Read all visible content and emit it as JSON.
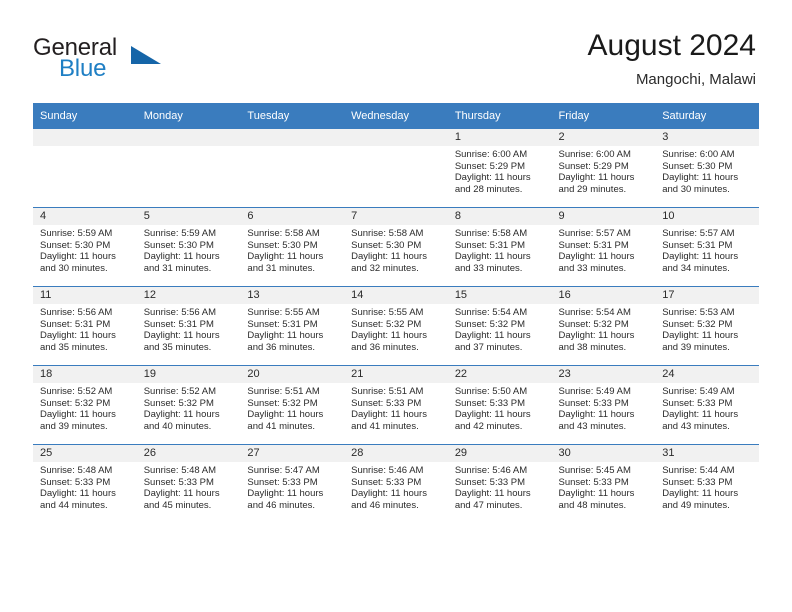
{
  "brand": {
    "name_part1": "General",
    "name_part2": "Blue",
    "logo_icon": "triangle-logo-icon",
    "accent_color": "#1f7fc4"
  },
  "header": {
    "title": "August 2024",
    "subtitle": "Mangochi, Malawi"
  },
  "theme": {
    "header_row_bg": "#3a7cbe",
    "daynum_band_bg": "#f1f1f1",
    "grid_line": "#3a7cbe",
    "text": "#2b2b2b"
  },
  "weekday_headers": [
    "Sunday",
    "Monday",
    "Tuesday",
    "Wednesday",
    "Thursday",
    "Friday",
    "Saturday"
  ],
  "weeks": [
    [
      {
        "day": "",
        "sunrise": "",
        "sunset": "",
        "daylight_line1": "",
        "daylight_line2": "",
        "empty": true
      },
      {
        "day": "",
        "sunrise": "",
        "sunset": "",
        "daylight_line1": "",
        "daylight_line2": "",
        "empty": true
      },
      {
        "day": "",
        "sunrise": "",
        "sunset": "",
        "daylight_line1": "",
        "daylight_line2": "",
        "empty": true
      },
      {
        "day": "",
        "sunrise": "",
        "sunset": "",
        "daylight_line1": "",
        "daylight_line2": "",
        "empty": true
      },
      {
        "day": "1",
        "sunrise": "Sunrise: 6:00 AM",
        "sunset": "Sunset: 5:29 PM",
        "daylight_line1": "Daylight: 11 hours",
        "daylight_line2": "and 28 minutes."
      },
      {
        "day": "2",
        "sunrise": "Sunrise: 6:00 AM",
        "sunset": "Sunset: 5:29 PM",
        "daylight_line1": "Daylight: 11 hours",
        "daylight_line2": "and 29 minutes."
      },
      {
        "day": "3",
        "sunrise": "Sunrise: 6:00 AM",
        "sunset": "Sunset: 5:30 PM",
        "daylight_line1": "Daylight: 11 hours",
        "daylight_line2": "and 30 minutes."
      }
    ],
    [
      {
        "day": "4",
        "sunrise": "Sunrise: 5:59 AM",
        "sunset": "Sunset: 5:30 PM",
        "daylight_line1": "Daylight: 11 hours",
        "daylight_line2": "and 30 minutes."
      },
      {
        "day": "5",
        "sunrise": "Sunrise: 5:59 AM",
        "sunset": "Sunset: 5:30 PM",
        "daylight_line1": "Daylight: 11 hours",
        "daylight_line2": "and 31 minutes."
      },
      {
        "day": "6",
        "sunrise": "Sunrise: 5:58 AM",
        "sunset": "Sunset: 5:30 PM",
        "daylight_line1": "Daylight: 11 hours",
        "daylight_line2": "and 31 minutes."
      },
      {
        "day": "7",
        "sunrise": "Sunrise: 5:58 AM",
        "sunset": "Sunset: 5:30 PM",
        "daylight_line1": "Daylight: 11 hours",
        "daylight_line2": "and 32 minutes."
      },
      {
        "day": "8",
        "sunrise": "Sunrise: 5:58 AM",
        "sunset": "Sunset: 5:31 PM",
        "daylight_line1": "Daylight: 11 hours",
        "daylight_line2": "and 33 minutes."
      },
      {
        "day": "9",
        "sunrise": "Sunrise: 5:57 AM",
        "sunset": "Sunset: 5:31 PM",
        "daylight_line1": "Daylight: 11 hours",
        "daylight_line2": "and 33 minutes."
      },
      {
        "day": "10",
        "sunrise": "Sunrise: 5:57 AM",
        "sunset": "Sunset: 5:31 PM",
        "daylight_line1": "Daylight: 11 hours",
        "daylight_line2": "and 34 minutes."
      }
    ],
    [
      {
        "day": "11",
        "sunrise": "Sunrise: 5:56 AM",
        "sunset": "Sunset: 5:31 PM",
        "daylight_line1": "Daylight: 11 hours",
        "daylight_line2": "and 35 minutes."
      },
      {
        "day": "12",
        "sunrise": "Sunrise: 5:56 AM",
        "sunset": "Sunset: 5:31 PM",
        "daylight_line1": "Daylight: 11 hours",
        "daylight_line2": "and 35 minutes."
      },
      {
        "day": "13",
        "sunrise": "Sunrise: 5:55 AM",
        "sunset": "Sunset: 5:31 PM",
        "daylight_line1": "Daylight: 11 hours",
        "daylight_line2": "and 36 minutes."
      },
      {
        "day": "14",
        "sunrise": "Sunrise: 5:55 AM",
        "sunset": "Sunset: 5:32 PM",
        "daylight_line1": "Daylight: 11 hours",
        "daylight_line2": "and 36 minutes."
      },
      {
        "day": "15",
        "sunrise": "Sunrise: 5:54 AM",
        "sunset": "Sunset: 5:32 PM",
        "daylight_line1": "Daylight: 11 hours",
        "daylight_line2": "and 37 minutes."
      },
      {
        "day": "16",
        "sunrise": "Sunrise: 5:54 AM",
        "sunset": "Sunset: 5:32 PM",
        "daylight_line1": "Daylight: 11 hours",
        "daylight_line2": "and 38 minutes."
      },
      {
        "day": "17",
        "sunrise": "Sunrise: 5:53 AM",
        "sunset": "Sunset: 5:32 PM",
        "daylight_line1": "Daylight: 11 hours",
        "daylight_line2": "and 39 minutes."
      }
    ],
    [
      {
        "day": "18",
        "sunrise": "Sunrise: 5:52 AM",
        "sunset": "Sunset: 5:32 PM",
        "daylight_line1": "Daylight: 11 hours",
        "daylight_line2": "and 39 minutes."
      },
      {
        "day": "19",
        "sunrise": "Sunrise: 5:52 AM",
        "sunset": "Sunset: 5:32 PM",
        "daylight_line1": "Daylight: 11 hours",
        "daylight_line2": "and 40 minutes."
      },
      {
        "day": "20",
        "sunrise": "Sunrise: 5:51 AM",
        "sunset": "Sunset: 5:32 PM",
        "daylight_line1": "Daylight: 11 hours",
        "daylight_line2": "and 41 minutes."
      },
      {
        "day": "21",
        "sunrise": "Sunrise: 5:51 AM",
        "sunset": "Sunset: 5:33 PM",
        "daylight_line1": "Daylight: 11 hours",
        "daylight_line2": "and 41 minutes."
      },
      {
        "day": "22",
        "sunrise": "Sunrise: 5:50 AM",
        "sunset": "Sunset: 5:33 PM",
        "daylight_line1": "Daylight: 11 hours",
        "daylight_line2": "and 42 minutes."
      },
      {
        "day": "23",
        "sunrise": "Sunrise: 5:49 AM",
        "sunset": "Sunset: 5:33 PM",
        "daylight_line1": "Daylight: 11 hours",
        "daylight_line2": "and 43 minutes."
      },
      {
        "day": "24",
        "sunrise": "Sunrise: 5:49 AM",
        "sunset": "Sunset: 5:33 PM",
        "daylight_line1": "Daylight: 11 hours",
        "daylight_line2": "and 43 minutes."
      }
    ],
    [
      {
        "day": "25",
        "sunrise": "Sunrise: 5:48 AM",
        "sunset": "Sunset: 5:33 PM",
        "daylight_line1": "Daylight: 11 hours",
        "daylight_line2": "and 44 minutes."
      },
      {
        "day": "26",
        "sunrise": "Sunrise: 5:48 AM",
        "sunset": "Sunset: 5:33 PM",
        "daylight_line1": "Daylight: 11 hours",
        "daylight_line2": "and 45 minutes."
      },
      {
        "day": "27",
        "sunrise": "Sunrise: 5:47 AM",
        "sunset": "Sunset: 5:33 PM",
        "daylight_line1": "Daylight: 11 hours",
        "daylight_line2": "and 46 minutes."
      },
      {
        "day": "28",
        "sunrise": "Sunrise: 5:46 AM",
        "sunset": "Sunset: 5:33 PM",
        "daylight_line1": "Daylight: 11 hours",
        "daylight_line2": "and 46 minutes."
      },
      {
        "day": "29",
        "sunrise": "Sunrise: 5:46 AM",
        "sunset": "Sunset: 5:33 PM",
        "daylight_line1": "Daylight: 11 hours",
        "daylight_line2": "and 47 minutes."
      },
      {
        "day": "30",
        "sunrise": "Sunrise: 5:45 AM",
        "sunset": "Sunset: 5:33 PM",
        "daylight_line1": "Daylight: 11 hours",
        "daylight_line2": "and 48 minutes."
      },
      {
        "day": "31",
        "sunrise": "Sunrise: 5:44 AM",
        "sunset": "Sunset: 5:33 PM",
        "daylight_line1": "Daylight: 11 hours",
        "daylight_line2": "and 49 minutes."
      }
    ]
  ]
}
